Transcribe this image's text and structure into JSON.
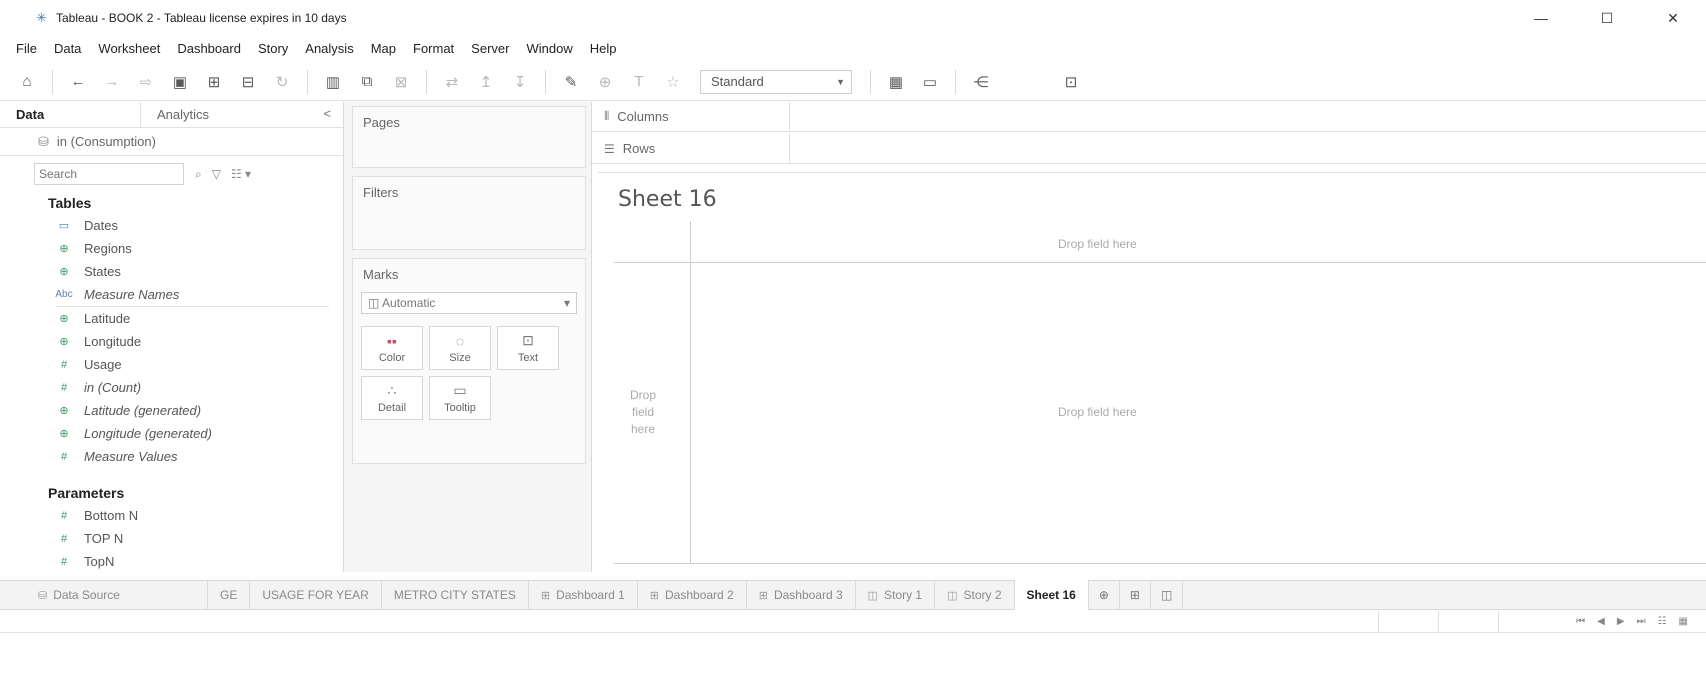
{
  "window": {
    "title": "Tableau - BOOK 2 - Tableau license expires in 10 days",
    "icon": "tableau-logo-icon",
    "controls": {
      "minimize": "—",
      "maximize": "☐",
      "close": "✕"
    }
  },
  "menu": [
    "File",
    "Data",
    "Worksheet",
    "Dashboard",
    "Story",
    "Analysis",
    "Map",
    "Format",
    "Server",
    "Window",
    "Help"
  ],
  "toolbar": {
    "fit_select": "Standard"
  },
  "data_pane": {
    "tabs": {
      "data": "Data",
      "analytics": "Analytics",
      "collapse": "<"
    },
    "datasource": "in (Consumption)",
    "search_placeholder": "Search",
    "tables_title": "Tables",
    "fields": [
      {
        "icon": "calendar-icon",
        "name": "Dates"
      },
      {
        "icon": "globe-icon",
        "name": "Regions"
      },
      {
        "icon": "globe-icon",
        "name": "States"
      },
      {
        "icon": "abc-icon",
        "name": "Measure Names"
      },
      {
        "icon": "globe-icon",
        "name": "Latitude"
      },
      {
        "icon": "globe-icon",
        "name": "Longitude"
      },
      {
        "icon": "measure-icon",
        "name": "Usage"
      },
      {
        "icon": "measure-icon",
        "name": "in (Count)"
      },
      {
        "icon": "globe-icon",
        "name": "Latitude (generated)"
      },
      {
        "icon": "globe-icon",
        "name": "Longitude (generated)"
      },
      {
        "icon": "measure-icon",
        "name": "Measure Values"
      }
    ],
    "parameters_title": "Parameters",
    "parameters": [
      "Bottom N",
      "TOP N",
      "TopN"
    ]
  },
  "shelves": {
    "pages": "Pages",
    "filters": "Filters",
    "marks": "Marks",
    "marks_type": "Automatic",
    "mark_buttons": {
      "color": "Color",
      "size": "Size",
      "text": "Text",
      "detail": "Detail",
      "tooltip": "Tooltip"
    },
    "columns": "Columns",
    "rows": "Rows"
  },
  "canvas": {
    "sheet_title": "Sheet 16",
    "drop_top": "Drop field here",
    "drop_center": "Drop field here",
    "drop_left_1": "Drop",
    "drop_left_2": "field",
    "drop_left_3": "here"
  },
  "tabs": {
    "data_source": "Data Source",
    "ge": "GE",
    "usage_for_year": "USAGE FOR YEAR",
    "metro_city_states": "METRO CITY STATES",
    "dashboard1": "Dashboard 1",
    "dashboard2": "Dashboard 2",
    "dashboard3": "Dashboard 3",
    "story1": "Story 1",
    "story2": "Story 2",
    "sheet16": "Sheet 16"
  }
}
